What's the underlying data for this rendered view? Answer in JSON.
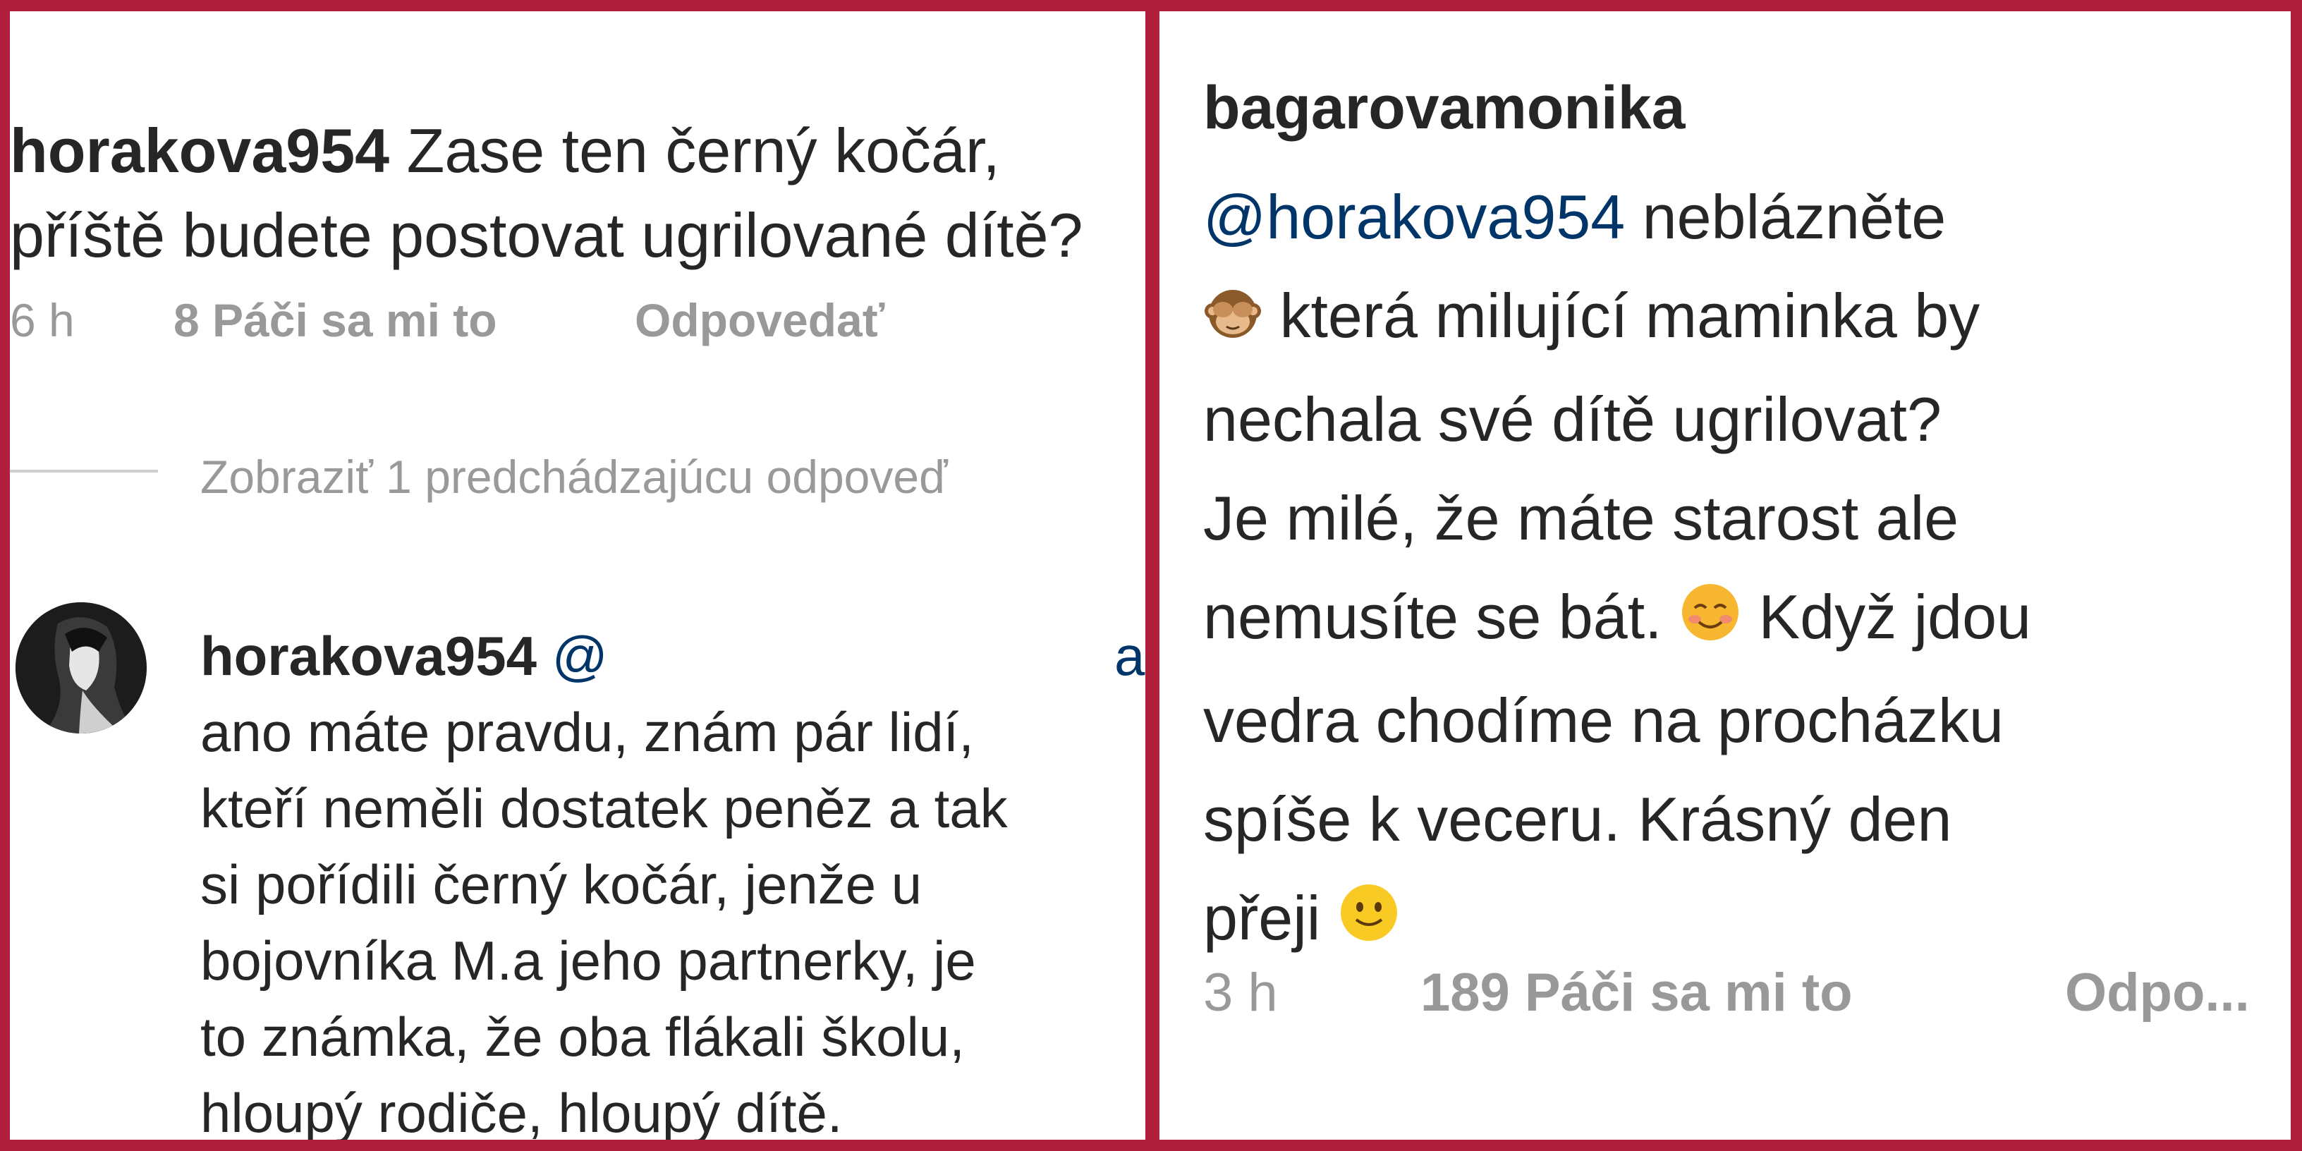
{
  "left_panel": {
    "comment1": {
      "username": "horakova954",
      "text_line1": "Zase ten černý kočár,",
      "text_line2": "příště budete postovat ugrilované dítě?",
      "time": "6 h",
      "likes": "8 Páči sa mi to",
      "reply": "Odpovedať"
    },
    "view_previous": "Zobraziť 1 predchádzajúcu odpoveď",
    "comment2": {
      "username": "horakova954",
      "mention_start": "@",
      "mention_end": "a",
      "lines": [
        "ano máte pravdu,  znám pár lidí,",
        "kteří neměli dostatek peněz a tak",
        "si pořídili černý kočár,  jenže u",
        "bojovníka M.a jeho partnerky,  je",
        "to známka,  že oba flákali školu,",
        "hloupý rodiče,  hloupý dítě."
      ]
    }
  },
  "right_panel": {
    "username": "bagarovamonika",
    "mention": "@horakova954",
    "line1_rest": " neblázněte",
    "line2": "která milující maminka by",
    "line3": "nechala své dítě ugrilovat?",
    "line4": "Je milé, že máte starost ale",
    "line5a": "nemusíte se bát.",
    "line5b": "Když jdou",
    "line6": "vedra chodíme na procházku",
    "line7": "spíše k veceru. Krásný den",
    "line8": "přeji",
    "time": "3 h",
    "likes": "189 Páči sa mi to",
    "reply": "Odpo..."
  },
  "icons": {
    "monkey": "see-no-evil-monkey-icon",
    "smile_blush": "smiling-face-icon",
    "smile": "slightly-smiling-face-icon"
  },
  "colors": {
    "frame": "#b01f3c",
    "text": "#262626",
    "meta": "#999999",
    "mention": "#003569"
  }
}
